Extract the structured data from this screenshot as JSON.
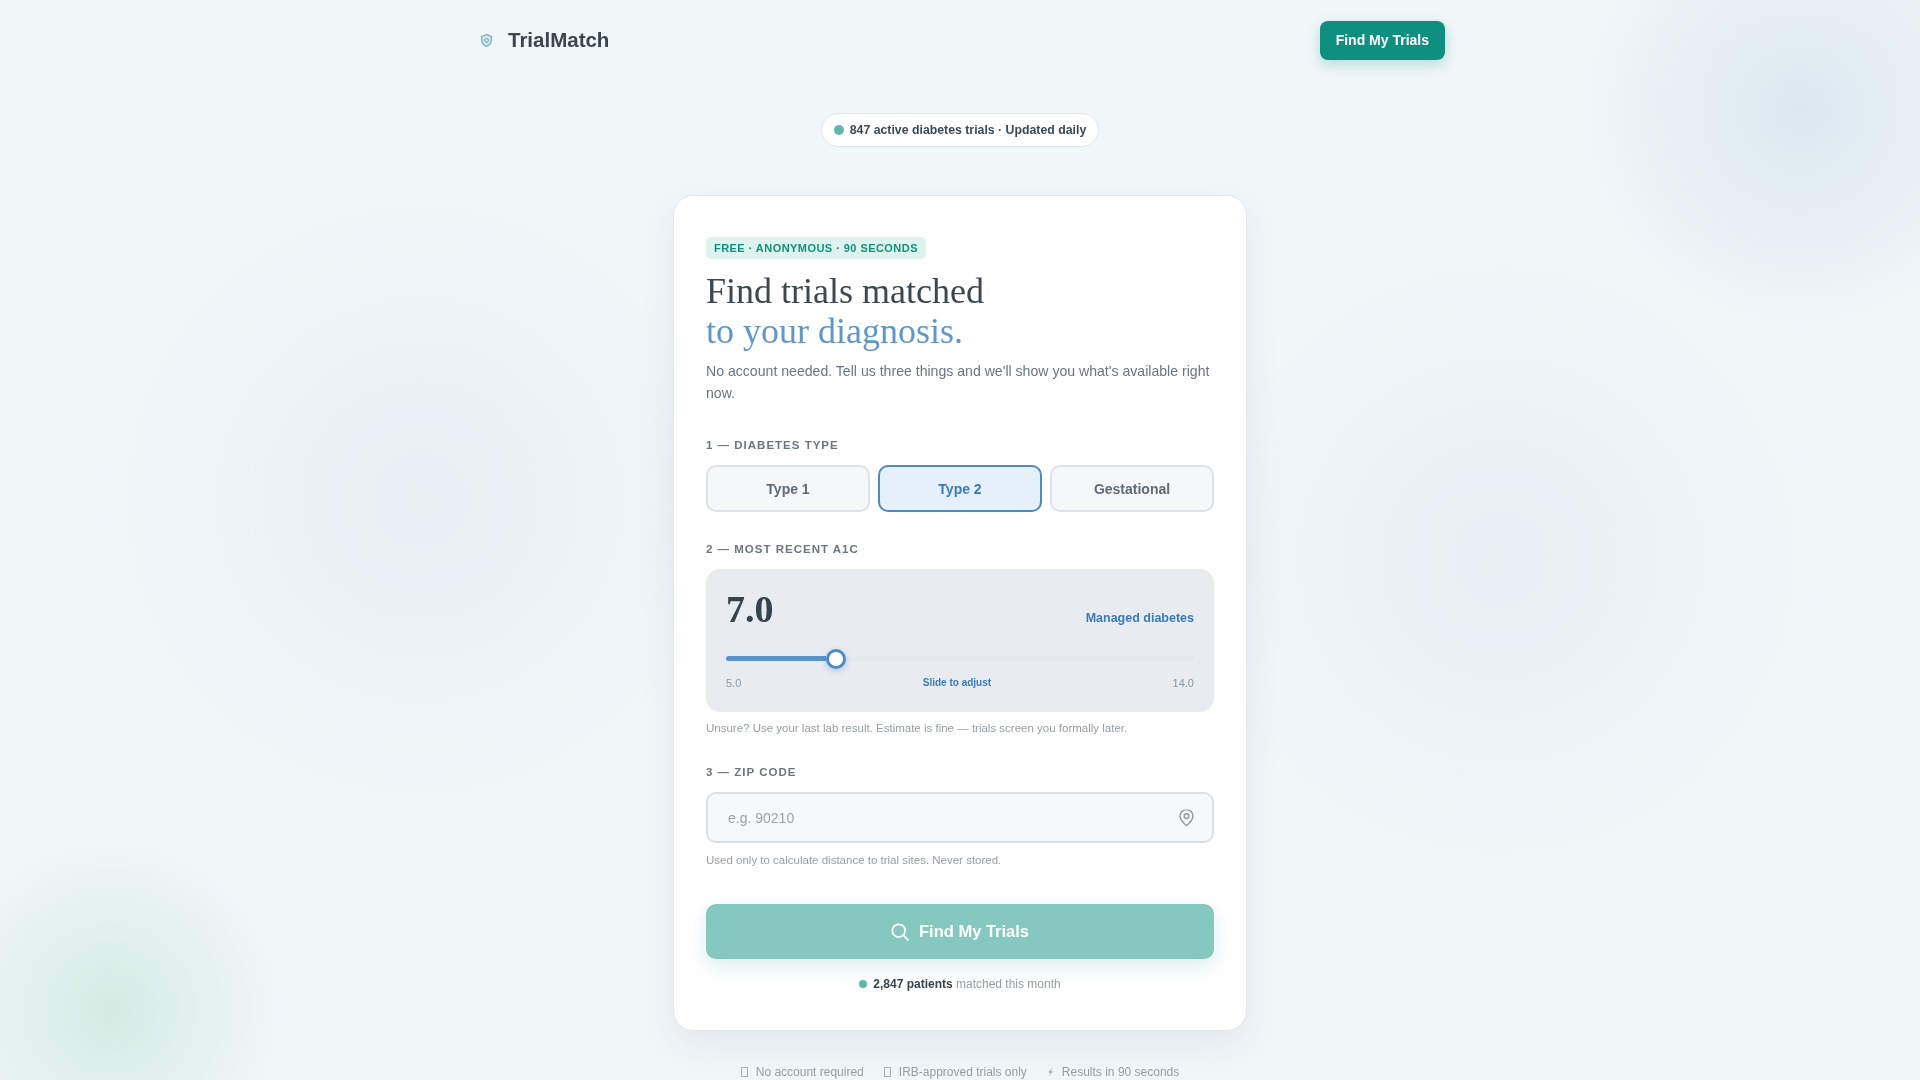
{
  "header": {
    "logo": "TrialMatch",
    "button": "Find My Trials"
  },
  "status_pill": {
    "text": "847 active diabetes trials · Updated daily"
  },
  "card": {
    "tag": "FREE · ANONYMOUS · 90 SECONDS",
    "title": "Find trials matched",
    "title_accent": "to your diagnosis.",
    "subtitle": "No account needed. Tell us three things and we'll show you what's available right now.",
    "diabetes_type": {
      "label": "1 — DIABETES TYPE",
      "options": [
        {
          "label": "Type 1",
          "selected": false
        },
        {
          "label": "Type 2",
          "selected": true
        },
        {
          "label": "Gestational",
          "selected": false
        }
      ]
    },
    "a1c": {
      "label": "2 — MOST RECENT A1C",
      "value": "7.0",
      "status": "Managed diabetes",
      "slider": {
        "level": 0.236
      },
      "min_label": "5.0",
      "hint_label": "Slide to adjust",
      "max_label": "14.0",
      "note": "Unsure? Use your last lab result. Estimate is fine — trials screen you formally later."
    },
    "zip": {
      "label": "3 — ZIP CODE",
      "placeholder": "e.g. 90210",
      "note": "Used only to calculate distance to trial sites. Never stored."
    },
    "submit": {
      "label": "Find My Trials",
      "disabled": true
    },
    "social_proof": "**2,847 patients** matched this month"
  },
  "footer": {
    "items": [
      {
        "kind": "missing-glyph",
        "text": "No account required"
      },
      {
        "kind": "missing-glyph",
        "text": "IRB-approved trials only"
      },
      {
        "kind": "lightning",
        "text": "Results in 90 seconds"
      }
    ]
  }
}
